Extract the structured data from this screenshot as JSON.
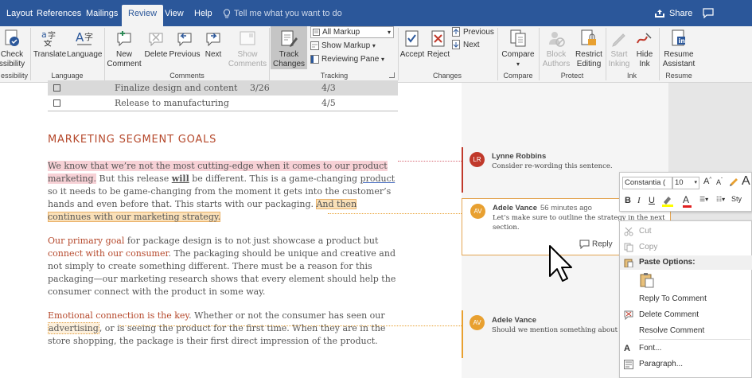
{
  "tabs": [
    {
      "label": "Layout",
      "active": false
    },
    {
      "label": "References",
      "active": false
    },
    {
      "label": "Mailings",
      "active": false
    },
    {
      "label": "Review",
      "active": true
    },
    {
      "label": "View",
      "active": false
    },
    {
      "label": "Help",
      "active": false
    }
  ],
  "tell_me": "Tell me what you want to do",
  "share_label": "Share",
  "ribbon": {
    "check_accessibility": [
      "Check",
      "ssibility"
    ],
    "translate": "Translate",
    "language": "Language",
    "new_comment": [
      "New",
      "Comment"
    ],
    "delete": "Delete",
    "previous": "Previous",
    "next": "Next",
    "show_comments": [
      "Show",
      "Comments"
    ],
    "track_changes": [
      "Track",
      "Changes"
    ],
    "all_markup": "All Markup",
    "show_markup": "Show Markup",
    "reviewing_pane": "Reviewing Pane",
    "accept": "Accept",
    "reject": "Reject",
    "changes_previous": "Previous",
    "changes_next": "Next",
    "compare": "Compare",
    "block_authors": [
      "Block",
      "Authors"
    ],
    "restrict_editing": [
      "Restrict",
      "Editing"
    ],
    "start_inking": [
      "Start",
      "Inking"
    ],
    "hide_ink": [
      "Hide",
      "Ink"
    ],
    "resume_assistant": [
      "Resume",
      "Assistant"
    ],
    "groups": {
      "accessibility": "essibility",
      "language": "Language",
      "comments": "Comments",
      "tracking": "Tracking",
      "changes": "Changes",
      "compare": "Compare",
      "protect": "Protect",
      "ink": "Ink",
      "resume": "Resume"
    }
  },
  "table_rows": [
    {
      "task": "Finalize design and content",
      "start": "3/26",
      "end": "4/3",
      "shaded": true
    },
    {
      "task": "Release to manufacturing",
      "start": "",
      "end": "4/5",
      "shaded": false
    }
  ],
  "document": {
    "heading": "MARKETING SEGMENT GOALS",
    "p1": {
      "hl1": "We know that we’re not the most cutting-edge when it comes to our product marketing.",
      "t1": " But this release ",
      "will": "will",
      "t2": " be different. This is a game-changing ",
      "product": "product",
      "t3": " so it needs to be game-changing from the moment it gets into the customer’s hands and even before that. This starts with our packaging. ",
      "hl2": "And then continues with our marketing strategy."
    },
    "p2": {
      "r1": "Our primary goal",
      "t1": " for package design is to not just showcase a product but ",
      "r2": "connect with our consumer",
      "t2": ". The packaging should be unique and creative and not simply to create something different. There must be a reason for this packaging—our marketing research shows that every element should help the consumer connect with the product in some way."
    },
    "p3": {
      "r1": "Emotional connection is the key",
      "t1": ". Whether or not the consumer has seen our ",
      "adv": "advertising",
      "t2": ", or is seeing the product for the first time. When they are in the store shopping, the package is their first direct impression of the product."
    }
  },
  "comments": [
    {
      "initials": "LR",
      "author": "Lynne Robbins",
      "time": "",
      "text": "Consider re-wording this sentence.",
      "color": "#c0392b"
    },
    {
      "initials": "AV",
      "author": "Adele Vance",
      "time": "56 minutes ago",
      "text": "Let’s make sure to outline the strategy in the next section.",
      "color": "#e8a030"
    },
    {
      "initials": "AV",
      "author": "Adele Vance",
      "time": "",
      "text": "Should we mention something about",
      "color": "#e8a030"
    }
  ],
  "reply_label": "Reply",
  "minibar": {
    "font": "Constantia (",
    "size": "10",
    "styles": "Sty"
  },
  "context_menu": {
    "cut": "Cut",
    "copy": "Copy",
    "paste_options": "Paste Options:",
    "reply_to_comment": "Reply To Comment",
    "delete_comment": "Delete Comment",
    "resolve_comment": "Resolve Comment",
    "font": "Font...",
    "paragraph": "Paragraph..."
  },
  "colors": {
    "brand": "#2b579a",
    "accent_red": "#b5482b",
    "comment_orange": "#e8a030",
    "comment_red": "#c0392b"
  }
}
